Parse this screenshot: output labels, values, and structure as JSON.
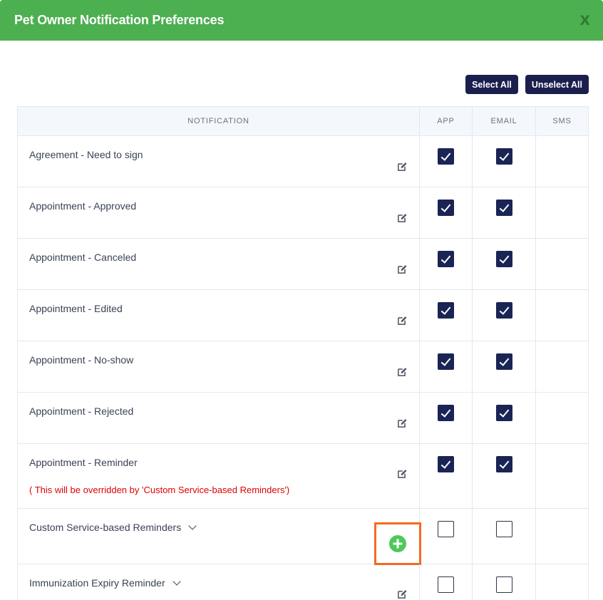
{
  "dialog": {
    "title": "Pet Owner Notification Preferences",
    "close_label": "X"
  },
  "toolbar": {
    "select_all": "Select All",
    "unselect_all": "Unselect All"
  },
  "table": {
    "headers": {
      "notification": "NOTIFICATION",
      "app": "APP",
      "email": "EMAIL",
      "sms": "SMS"
    },
    "rows": [
      {
        "label": "Agreement - Need to sign",
        "app": true,
        "email": true,
        "action": "edit"
      },
      {
        "label": "Appointment - Approved",
        "app": true,
        "email": true,
        "action": "edit"
      },
      {
        "label": "Appointment - Canceled",
        "app": true,
        "email": true,
        "action": "edit"
      },
      {
        "label": "Appointment - Edited",
        "app": true,
        "email": true,
        "action": "edit"
      },
      {
        "label": "Appointment - No-show",
        "app": true,
        "email": true,
        "action": "edit"
      },
      {
        "label": "Appointment - Rejected",
        "app": true,
        "email": true,
        "action": "edit"
      },
      {
        "label": "Appointment - Reminder",
        "note": "( This will be overridden by 'Custom Service-based Reminders')",
        "app": true,
        "email": true,
        "action": "edit"
      },
      {
        "label": "Custom Service-based Reminders",
        "expandable": true,
        "app": false,
        "email": false,
        "action": "add"
      },
      {
        "label": "Immunization Expiry Reminder",
        "expandable": true,
        "app": false,
        "email": false,
        "action": "edit"
      }
    ]
  },
  "colors": {
    "header_bg": "#4caf50",
    "button_bg": "#1a1f4e",
    "checkbox_on": "#1a2455",
    "note_text": "#e00000",
    "add_highlight": "#f36a1f",
    "add_icon": "#4cc95a"
  },
  "icons": {
    "edit": "edit-icon",
    "add": "plus-circle-icon",
    "expand": "chevron-down-icon"
  }
}
